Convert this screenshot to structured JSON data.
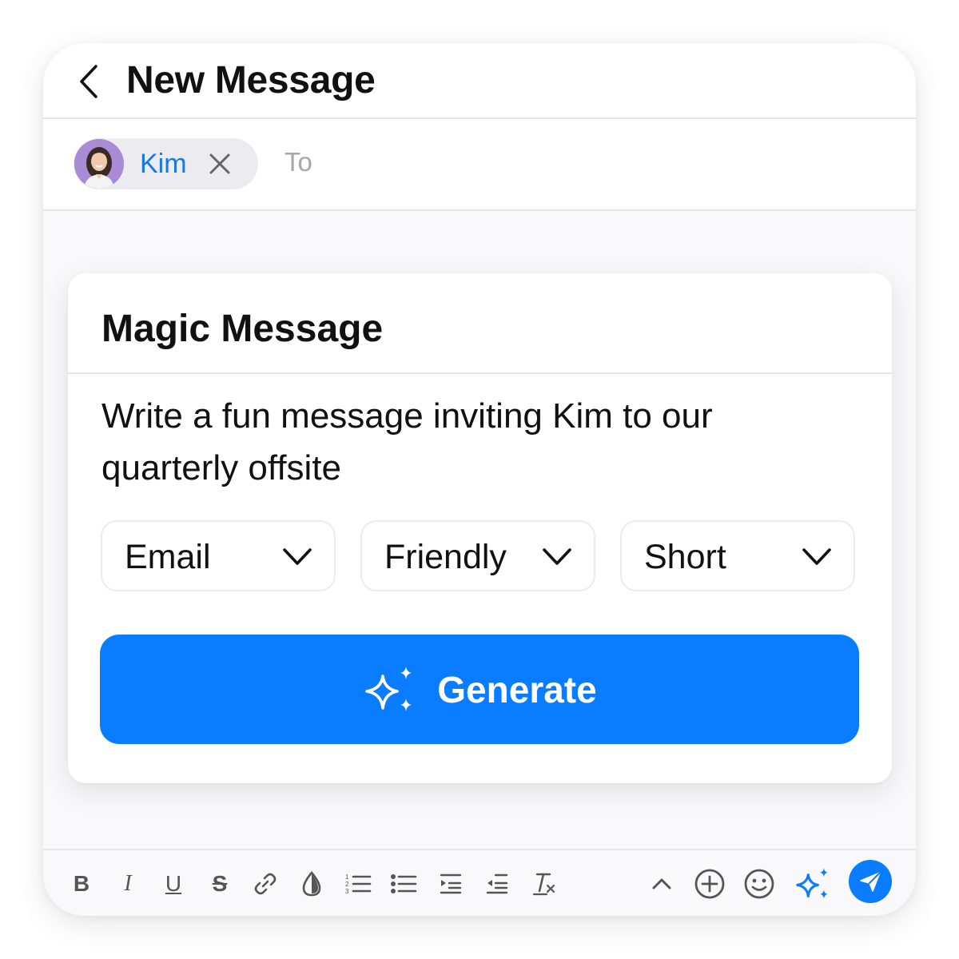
{
  "header": {
    "title": "New Message",
    "back_icon": "chevron-left-icon"
  },
  "recipients": {
    "chip": {
      "name": "Kim",
      "avatar": "avatar",
      "remove_icon": "close-icon"
    },
    "to_label": "To"
  },
  "magic": {
    "title": "Magic Message",
    "prompt": "Write a fun message inviting Kim to our quarterly offsite",
    "selects": [
      {
        "value": "Email",
        "icon": "chevron-down-icon"
      },
      {
        "value": "Friendly",
        "icon": "chevron-down-icon"
      },
      {
        "value": "Short",
        "icon": "chevron-down-icon"
      }
    ],
    "generate_label": "Generate",
    "generate_icon": "sparkles-icon"
  },
  "toolbar": {
    "bold": "B",
    "italic": "I",
    "underline": "U",
    "strike": "S",
    "icons": [
      "bold-icon",
      "italic-icon",
      "underline-icon",
      "strikethrough-icon",
      "link-icon",
      "text-color-icon",
      "numbered-list-icon",
      "bulleted-list-icon",
      "indent-icon",
      "outdent-icon",
      "clear-format-icon",
      "chevron-up-icon",
      "add-icon",
      "emoji-icon",
      "sparkles-icon",
      "send-icon"
    ]
  },
  "colors": {
    "accent": "#0a7cff",
    "chip_text": "#1677e8",
    "background": "#f9f9fb"
  }
}
